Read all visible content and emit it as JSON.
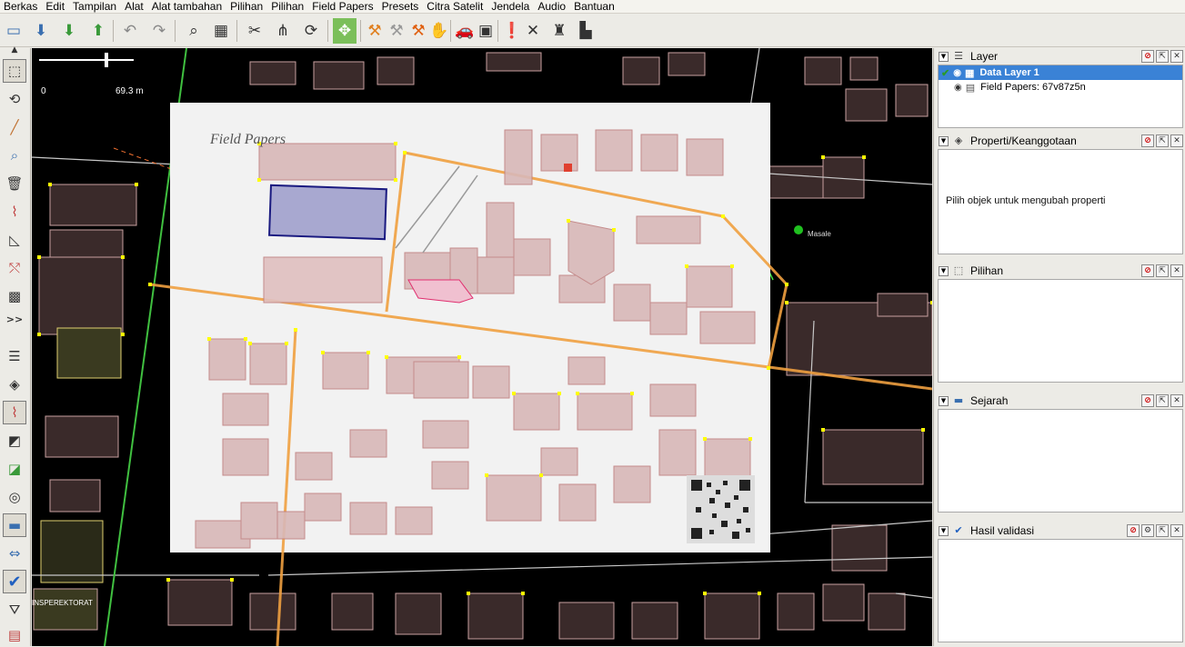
{
  "menu": [
    "Berkas",
    "Edit",
    "Tampilan",
    "Alat",
    "Alat tambahan",
    "Pilihan",
    "Pilihan",
    "Field Papers",
    "Presets",
    "Citra Satelit",
    "Jendela",
    "Audio",
    "Bantuan"
  ],
  "toolbar": {
    "buttons": [
      "open-file-icon",
      "save-icon",
      "download-icon",
      "upload-icon",
      "undo-icon",
      "redo-icon",
      "zoom-icon",
      "preferences-icon",
      "split-way-icon",
      "combine-way-icon",
      "refresh-icon",
      "auto-zoom-icon",
      "draw-tool-icon",
      "draw-tool-icon",
      "draw-tool-icon",
      "hand-icon",
      "car-icon",
      "bus-icon",
      "warning-icon",
      "close-icon",
      "castle-icon",
      "factory-icon"
    ]
  },
  "left_toolbar": {
    "more_label": ">>"
  },
  "map": {
    "scale": {
      "start": "0",
      "end": "69.3 m"
    },
    "labels": {
      "masale": "Masale",
      "insperektorat": "INSPEREKTORAT",
      "field_papers_title": "Field Papers"
    }
  },
  "panels": {
    "layer": {
      "title": "Layer",
      "items": [
        {
          "name": "Data Layer 1",
          "selected": true
        },
        {
          "name": "Field Papers: 67v87z5n",
          "selected": false
        }
      ]
    },
    "properties": {
      "title": "Properti/Keanggotaan",
      "empty_text": "Pilih objek untuk mengubah properti"
    },
    "selection": {
      "title": "Pilihan"
    },
    "history": {
      "title": "Sejarah"
    },
    "validation": {
      "title": "Hasil validasi"
    }
  },
  "colors": {
    "map_background": "#000000",
    "building_fill": "#3a2a2a",
    "building_stroke": "#c8a0a0",
    "node": "#ffff00",
    "road_orange": "#f0a040",
    "road_gray": "#c8c8c8",
    "selected_layer": "#3a82d6",
    "boundary_green": "#40c040"
  }
}
